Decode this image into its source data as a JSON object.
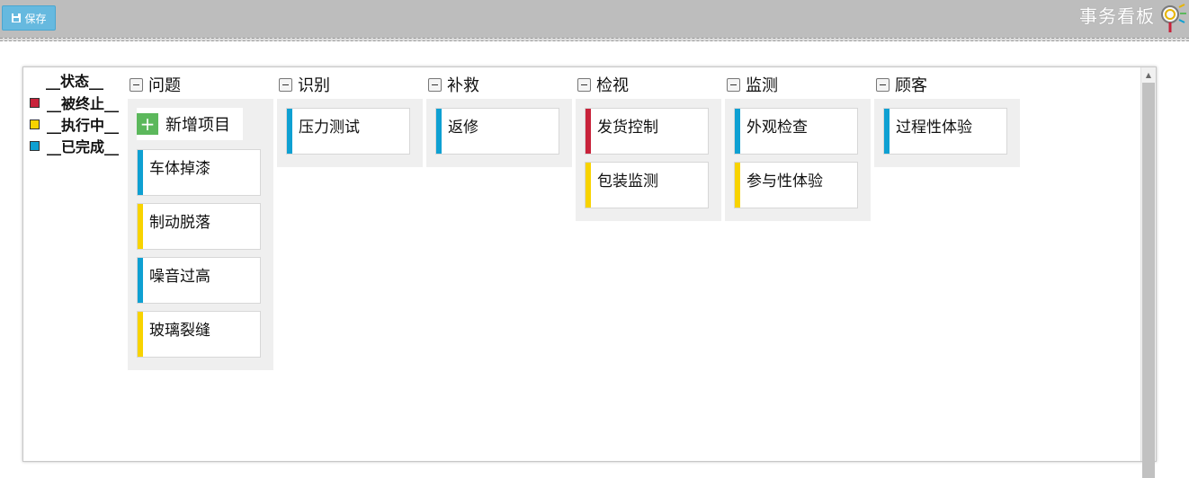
{
  "toolbar": {
    "save_label": "保存",
    "title": "事务看板"
  },
  "legend": {
    "title": "__状态__",
    "items": [
      {
        "label": "__被终止__",
        "color": "#c8223a"
      },
      {
        "label": "__执行中__",
        "color": "#f8d300"
      },
      {
        "label": "__已完成__",
        "color": "#0ea0d2"
      }
    ]
  },
  "colors": {
    "terminated": "#c8223a",
    "in_progress": "#f8d300",
    "done": "#0ea0d2"
  },
  "add_item_label": "新增项目",
  "columns": [
    {
      "title": "问题",
      "cards": [
        {
          "label": "车体掉漆",
          "status": "done"
        },
        {
          "label": "制动脱落",
          "status": "in_progress"
        },
        {
          "label": "噪音过高",
          "status": "done"
        },
        {
          "label": "玻璃裂缝",
          "status": "in_progress"
        }
      ]
    },
    {
      "title": "识别",
      "cards": [
        {
          "label": "压力测试",
          "status": "done"
        }
      ]
    },
    {
      "title": "补救",
      "cards": [
        {
          "label": "返修",
          "status": "done"
        }
      ]
    },
    {
      "title": "检视",
      "cards": [
        {
          "label": "发货控制",
          "status": "terminated"
        },
        {
          "label": "包装监测",
          "status": "in_progress"
        }
      ]
    },
    {
      "title": "监测",
      "cards": [
        {
          "label": "外观检查",
          "status": "done"
        },
        {
          "label": "参与性体验",
          "status": "in_progress"
        }
      ]
    },
    {
      "title": "顾客",
      "cards": [
        {
          "label": "过程性体验",
          "status": "done"
        }
      ]
    }
  ]
}
